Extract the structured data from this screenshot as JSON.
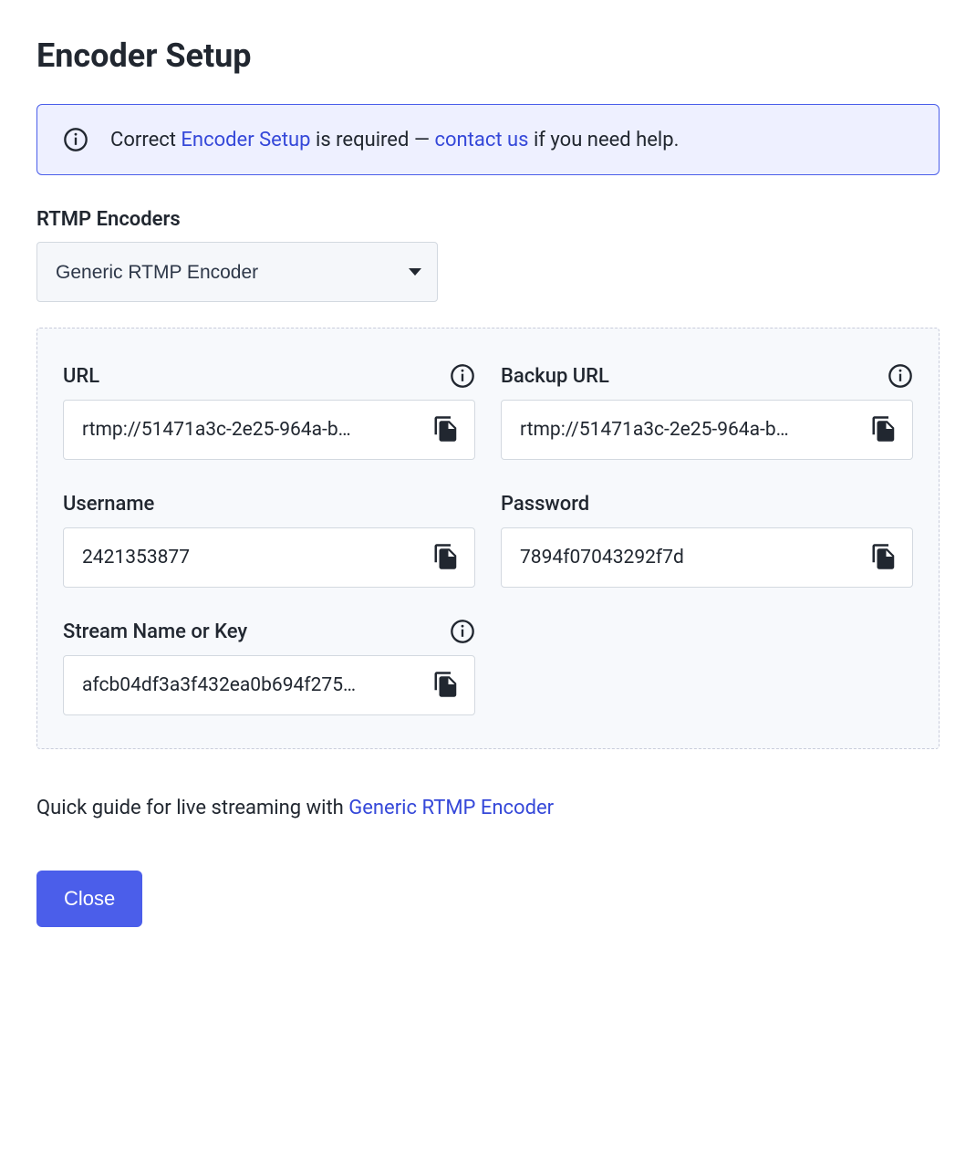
{
  "title": "Encoder Setup",
  "banner": {
    "prefix": "Correct ",
    "link1": "Encoder Setup",
    "mid": " is required — ",
    "link2": "contact us",
    "suffix": " if you need help."
  },
  "encoders": {
    "label": "RTMP Encoders",
    "selected": "Generic RTMP Encoder"
  },
  "fields": {
    "url": {
      "label": "URL",
      "value": "rtmp://51471a3c-2e25-964a-b…",
      "has_info": true
    },
    "backup_url": {
      "label": "Backup URL",
      "value": "rtmp://51471a3c-2e25-964a-b…",
      "has_info": true
    },
    "username": {
      "label": "Username",
      "value": "2421353877",
      "has_info": false
    },
    "password": {
      "label": "Password",
      "value": "7894f07043292f7d",
      "has_info": false
    },
    "stream_key": {
      "label": "Stream Name or Key",
      "value": "afcb04df3a3f432ea0b694f275…",
      "has_info": true
    }
  },
  "quick_guide": {
    "prefix": "Quick guide for live streaming with ",
    "link": "Generic RTMP Encoder"
  },
  "close": "Close"
}
